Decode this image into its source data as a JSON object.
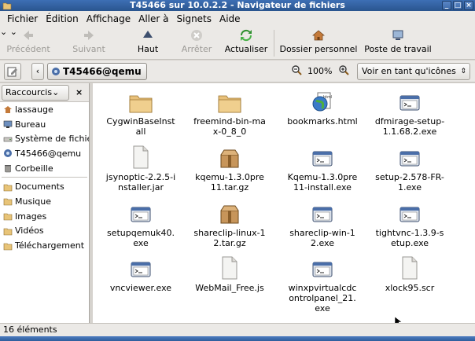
{
  "window": {
    "title": "T45466 sur 10.0.2.2 - Navigateur de fichiers"
  },
  "menu": [
    "Fichier",
    "Édition",
    "Affichage",
    "Aller à",
    "Signets",
    "Aide"
  ],
  "toolbar": {
    "back": "Précédent",
    "forward": "Suivant",
    "up": "Haut",
    "stop": "Arrêter",
    "reload": "Actualiser",
    "home": "Dossier personnel",
    "computer": "Poste de travail"
  },
  "location": {
    "crumb": "T45466@qemu",
    "zoom": "100%",
    "view_mode": "Voir en tant qu'icônes"
  },
  "sidebar": {
    "title": "Raccourcis",
    "items": [
      {
        "label": "lassauge",
        "icon": "home-icon"
      },
      {
        "label": "Bureau",
        "icon": "desktop-icon"
      },
      {
        "label": "Système de fichiers",
        "icon": "drive-icon"
      },
      {
        "label": "T45466@qemu",
        "icon": "network-icon"
      },
      {
        "label": "Corbeille",
        "icon": "trash-icon"
      }
    ],
    "bookmarks": [
      {
        "label": "Documents",
        "icon": "folder-icon"
      },
      {
        "label": "Musique",
        "icon": "folder-icon"
      },
      {
        "label": "Images",
        "icon": "folder-icon"
      },
      {
        "label": "Vidéos",
        "icon": "folder-icon"
      },
      {
        "label": "Téléchargement",
        "icon": "folder-icon"
      }
    ]
  },
  "files": [
    {
      "name": "CygwinBaseInstall",
      "icon": "folder-icon"
    },
    {
      "name": "freemind-bin-max-0_8_0",
      "icon": "folder-icon"
    },
    {
      "name": "bookmarks.html",
      "icon": "html-icon"
    },
    {
      "name": "dfmirage-setup-1.1.68.2.exe",
      "icon": "executable-icon"
    },
    {
      "name": "jsynoptic-2.2.5-installer.jar",
      "icon": "file-icon"
    },
    {
      "name": "kqemu-1.3.0pre11.tar.gz",
      "icon": "archive-icon"
    },
    {
      "name": "Kqemu-1.3.0pre11-install.exe",
      "icon": "executable-icon"
    },
    {
      "name": "setup-2.578-FR-1.exe",
      "icon": "executable-icon"
    },
    {
      "name": "setupqemuk40.exe",
      "icon": "executable-icon"
    },
    {
      "name": "shareclip-linux-12.tar.gz",
      "icon": "archive-icon"
    },
    {
      "name": "shareclip-win-12.exe",
      "icon": "executable-icon"
    },
    {
      "name": "tightvnc-1.3.9-setup.exe",
      "icon": "executable-icon"
    },
    {
      "name": "vncviewer.exe",
      "icon": "executable-icon"
    },
    {
      "name": "WebMail_Free.js",
      "icon": "file-icon"
    },
    {
      "name": "winxpvirtualcdcontrolpanel_21.exe",
      "icon": "executable-icon"
    },
    {
      "name": "xlock95.scr",
      "icon": "file-icon"
    }
  ],
  "status": "16 éléments"
}
